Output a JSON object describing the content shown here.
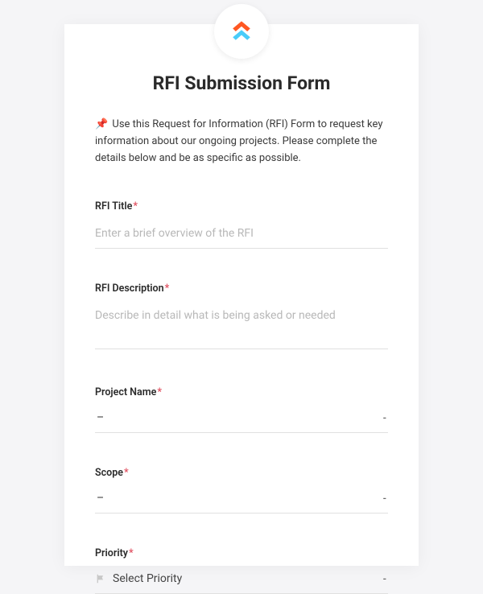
{
  "logo": {
    "name": "clickup-logo"
  },
  "title": "RFI Submission Form",
  "intro": {
    "emoji": "📌",
    "text": "Use this Request for Information (RFI) Form to request key information about our ongoing projects. Please complete the details below and be as specific as possible."
  },
  "fields": {
    "rfi_title": {
      "label": "RFI Title",
      "required": "*",
      "placeholder": "Enter a brief overview of the RFI",
      "value": ""
    },
    "rfi_description": {
      "label": "RFI Description",
      "required": "*",
      "placeholder": "Describe in detail what is being asked or needed",
      "value": ""
    },
    "project_name": {
      "label": "Project Name",
      "required": "*",
      "value": "–",
      "indicator": "-"
    },
    "scope": {
      "label": "Scope",
      "required": "*",
      "value": "–",
      "indicator": "-"
    },
    "priority": {
      "label": "Priority",
      "required": "*",
      "placeholder": "Select Priority",
      "indicator": "-"
    }
  }
}
